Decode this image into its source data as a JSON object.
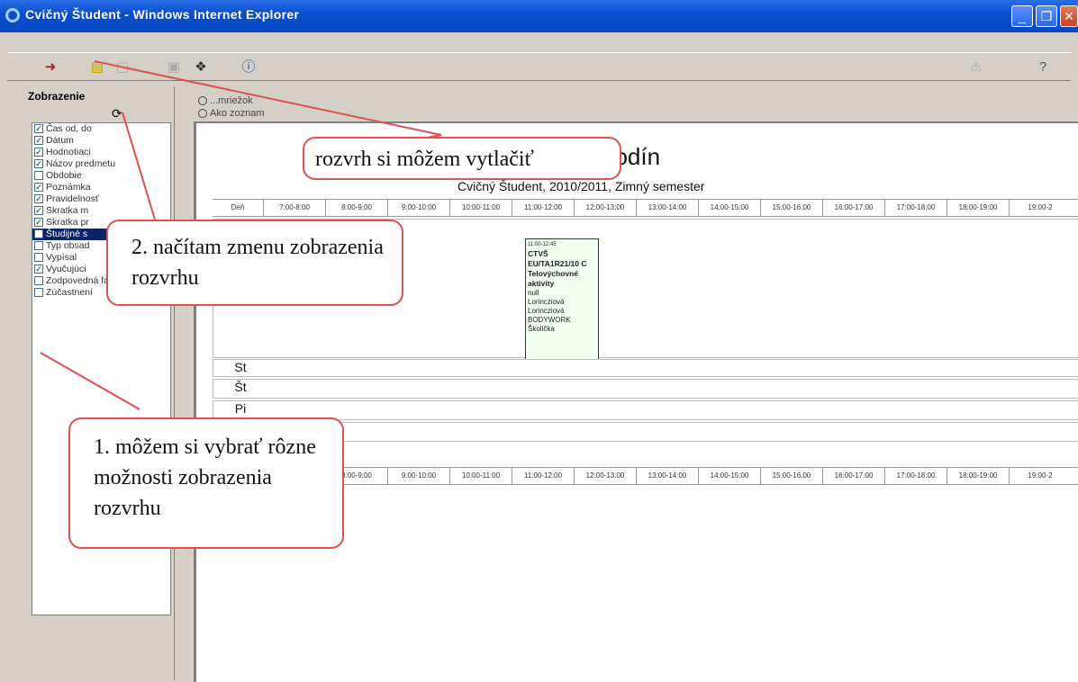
{
  "window": {
    "title": "Cvičný Študent - Windows Internet Explorer",
    "buttons": [
      "_",
      "❐",
      "✕"
    ]
  },
  "toolbar": {
    "icons": [
      "exit-icon",
      "print-icon",
      "disabled-icon",
      "disabled-icon",
      "export-icon",
      "info-icon",
      "warning-icon",
      "help-icon"
    ]
  },
  "sidebar": {
    "heading": "Zobrazenie",
    "options": [
      {
        "label": "Čas od, do",
        "checked": true
      },
      {
        "label": "Dátum",
        "checked": true
      },
      {
        "label": "Hodnotiaci",
        "checked": true
      },
      {
        "label": "Názov predmetu",
        "checked": true
      },
      {
        "label": "Obdobie",
        "checked": false
      },
      {
        "label": "Poznámka",
        "checked": true
      },
      {
        "label": "Pravidelnosť",
        "checked": true
      },
      {
        "label": "Skratka m",
        "checked": true
      },
      {
        "label": "Skratka pr",
        "checked": true
      },
      {
        "label": "Študijné s",
        "checked": false,
        "selected": true
      },
      {
        "label": "Typ obsad",
        "checked": false
      },
      {
        "label": "Vypísal",
        "checked": false
      },
      {
        "label": "Vyučujúci",
        "checked": true
      },
      {
        "label": "Zodpovedná fakulta",
        "checked": false
      },
      {
        "label": "Zúčastnení",
        "checked": false
      }
    ]
  },
  "view": {
    "option1": "...mriežok",
    "option2": "Ako zoznam"
  },
  "schedule": {
    "title": "hodín",
    "subtitle": "Cvičný Študent, 2010/2011, Zimný semester",
    "header_label": "Deň",
    "times": [
      "7:00-8:00",
      "8:00-9:00",
      "9:00-10:00",
      "10:00-11:00",
      "11:00-12:00",
      "12:00-13:00",
      "13:00-14:00",
      "14:00-15:00",
      "15:00-16:00",
      "16:00-17:00",
      "17:00-18:00",
      "18:00-19:00",
      "19:00-2"
    ],
    "days": [
      "St",
      "Št",
      "Pi"
    ],
    "event": {
      "time": "11:00-12:45",
      "code": "CTVŠ",
      "group": "EU/TA1R21/10 C",
      "name": "Telovýchovné aktivity",
      "note": "null",
      "teacher1": "Lorincziová",
      "teacher2": "Lorincziová",
      "room": "BODYWORK",
      "place": "Školička"
    }
  },
  "callouts": {
    "print": "rozvrh si môžem vytlačiť",
    "reload": "2. načítam zmenu zobrazenia rozvrhu",
    "choose": "1. môžem si vybrať rôzne možnosti zobrazenia rozvrhu"
  },
  "colors": {
    "titlebar": "#0a4fd0",
    "callout_border": "#e05050",
    "event_bg": "#f0fff0"
  }
}
